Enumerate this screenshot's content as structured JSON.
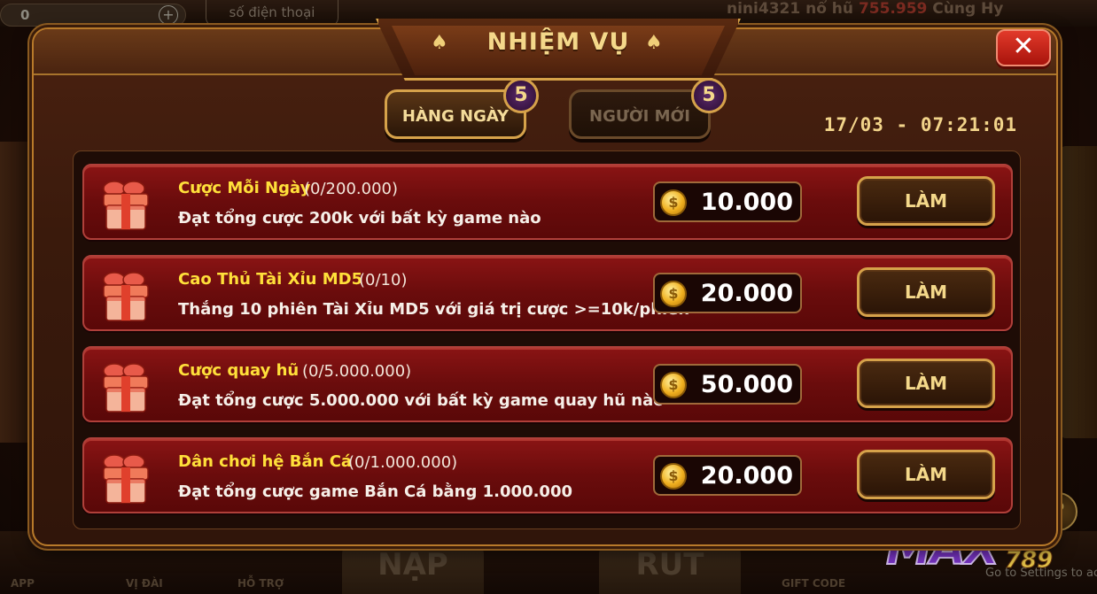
{
  "background": {
    "coin_amount": "0",
    "phone_hint": "số điện thoại",
    "ticker": {
      "user": "nini4321",
      "text": " nổ hũ ",
      "amount": "755.959",
      "tail": " Cùng Hy"
    },
    "bottom_buttons": [
      "NẠP",
      "RÚT"
    ],
    "bottom_small_labels": [
      "APP",
      "VỊ ĐÀI",
      "HỖ TRỢ",
      "GIFT CODE"
    ],
    "logo_main": "MAX",
    "logo_num": "789",
    "help": "?",
    "windows_hint": "Go to Settings to ac"
  },
  "modal": {
    "title": "NHIỆM VỤ",
    "close_label": "✕",
    "tabs": [
      {
        "label": "HÀNG NGÀY",
        "badge": "5",
        "active": true
      },
      {
        "label": "NGƯỜI MỚI",
        "badge": "5",
        "active": false
      }
    ],
    "timestamp": "17/03 - 07:21:01",
    "quests": [
      {
        "title": "Cược Mỗi Ngày",
        "progress": "(0/200.000)",
        "description": "Đạt tổng cược 200k với bất kỳ game nào",
        "reward": "10.000",
        "action": "LÀM"
      },
      {
        "title": "Cao Thủ Tài Xỉu MD5",
        "progress": "(0/10)",
        "description": "Thắng 10 phiên Tài Xỉu MD5 với giá trị cược >=10k/phiên",
        "reward": "20.000",
        "action": "LÀM"
      },
      {
        "title": "Cược quay hũ",
        "progress": "(0/5.000.000)",
        "description": "Đạt tổng cược 5.000.000 với bất kỳ game quay hũ nào",
        "reward": "50.000",
        "action": "LÀM"
      },
      {
        "title": "Dân chơi hệ Bắn Cá",
        "progress": "(0/1.000.000)",
        "description": "Đạt tổng cược game Bắn Cá bằng 1.000.000",
        "reward": "20.000",
        "action": "LÀM"
      }
    ]
  },
  "colors": {
    "quest_title": "#ffe03a",
    "gold": "#f4d88a",
    "row_red": "#8a1414"
  }
}
